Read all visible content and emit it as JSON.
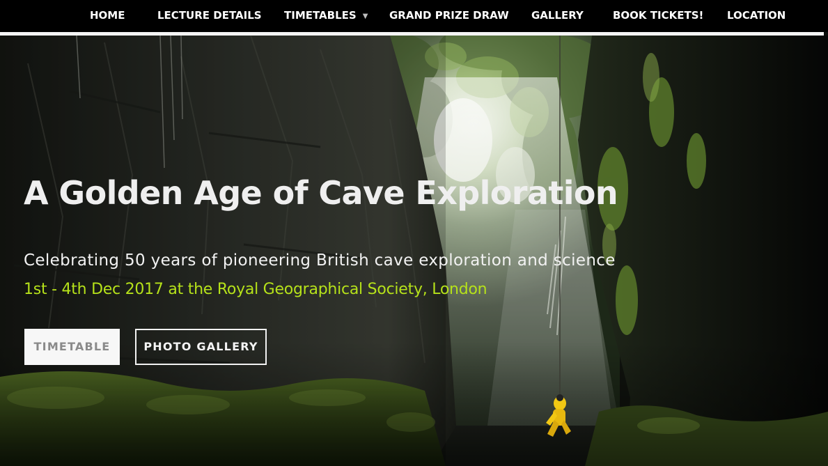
{
  "nav": {
    "items": [
      {
        "label": "HOME"
      },
      {
        "label": "LECTURE DETAILS"
      },
      {
        "label": "TIMETABLES",
        "caret": "⌵"
      },
      {
        "label": "GRAND PRIZE DRAW"
      },
      {
        "label": "GALLERY"
      },
      {
        "label": "BOOK TICKETS!"
      },
      {
        "label": "LOCATION"
      }
    ]
  },
  "hero": {
    "title": "A Golden Age of Cave Exploration",
    "subtitle": "Celebrating 50 years of pioneering British cave exploration and science",
    "date_line": "1st - 4th Dec 2017 at the Royal Geographical Society, London",
    "buttons": {
      "timetable": "TIMETABLE",
      "gallery": "PHOTO GALLERY"
    },
    "image_alt": "caver-on-rope-in-cave-shaft"
  },
  "colors": {
    "nav_bg": "#000000",
    "nav_text": "#ffffff",
    "accent_green": "#b6e21a",
    "title_text": "#efefef",
    "button_light_bg": "#f7f7f7",
    "button_light_text": "#8a8a8a",
    "caver_suit": "#f2c813"
  },
  "icons": {
    "dropdown_caret": "chevron-down-icon"
  }
}
